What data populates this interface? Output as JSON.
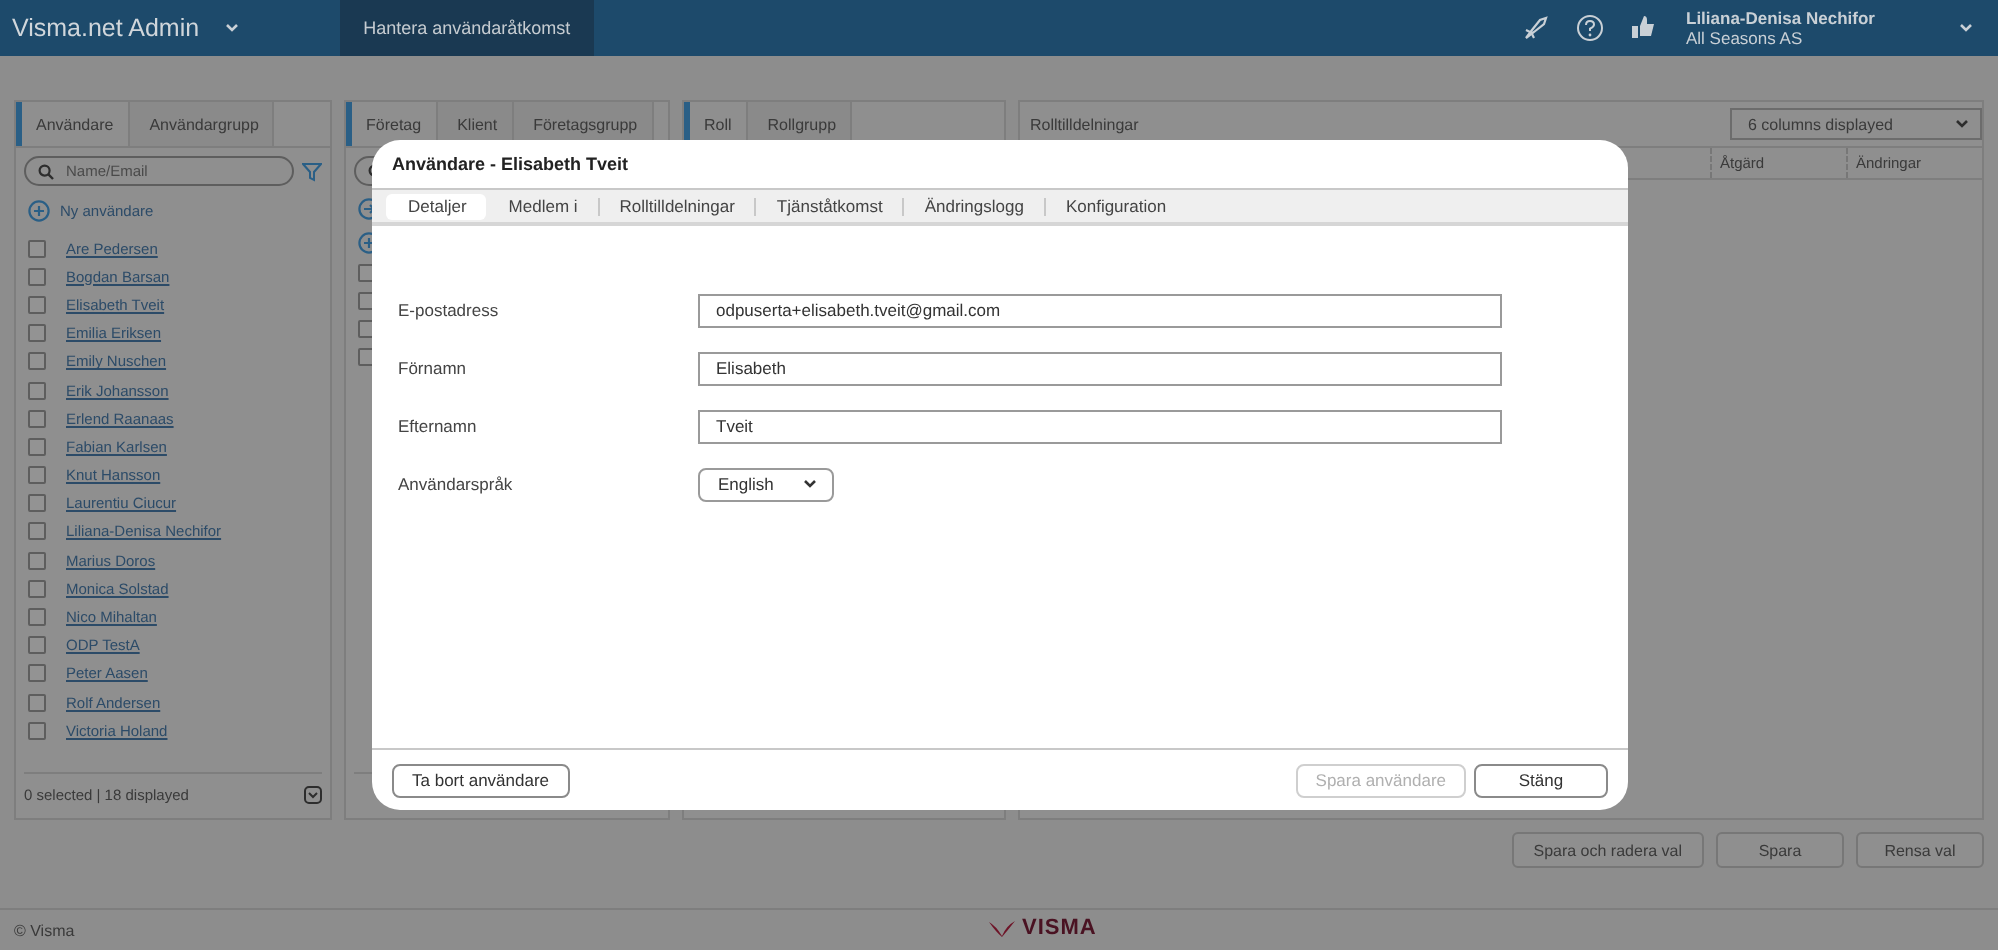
{
  "header": {
    "app_title": "Visma.net Admin",
    "nav_tab": "Hantera användaråtkomst",
    "user_name": "Liliana-Denisa Nechifor",
    "company": "All Seasons AS"
  },
  "users_panel": {
    "tabs": [
      {
        "label": "Användare",
        "selected": true
      },
      {
        "label": "Användargrupp",
        "selected": false
      }
    ],
    "search": {
      "placeholder": "Name/Email"
    },
    "new_link": "Ny användare",
    "users": [
      {
        "name": "Are Pedersen",
        "checked": false
      },
      {
        "name": "Bogdan Barsan",
        "checked": false
      },
      {
        "name": "Elisabeth Tveit",
        "checked": false
      },
      {
        "name": "Emilia Eriksen",
        "checked": false
      },
      {
        "name": "Emily Nuschen",
        "checked": false
      },
      {
        "name": "Erik Johansson",
        "checked": false
      },
      {
        "name": "Erlend Raanaas",
        "checked": false
      },
      {
        "name": "Fabian Karlsen",
        "checked": false
      },
      {
        "name": "Knut Hansson",
        "checked": false
      },
      {
        "name": "Laurentiu Ciucur",
        "checked": false
      },
      {
        "name": "Liliana-Denisa Nechifor",
        "checked": false
      },
      {
        "name": "Marius Doros",
        "checked": false
      },
      {
        "name": "Monica Solstad",
        "checked": false
      },
      {
        "name": "Nico Mihaltan",
        "checked": false
      },
      {
        "name": "ODP TestA",
        "checked": false
      },
      {
        "name": "Peter Aasen",
        "checked": false
      },
      {
        "name": "Rolf Andersen",
        "checked": false
      },
      {
        "name": "Victoria Holand",
        "checked": false
      }
    ],
    "status": "0 selected | 18 displayed"
  },
  "companies_panel": {
    "tabs": [
      {
        "label": "Företag",
        "selected": true
      },
      {
        "label": "Klient",
        "selected": false
      },
      {
        "label": "Företagsgrupp",
        "selected": false
      }
    ],
    "rows": [
      {
        "checked": false
      },
      {
        "checked": false
      },
      {
        "checked": false
      },
      {
        "checked": false
      }
    ]
  },
  "roles_panel": {
    "tabs": [
      {
        "label": "Roll",
        "selected": true
      },
      {
        "label": "Rollgrupp",
        "selected": false
      }
    ]
  },
  "assignments_panel": {
    "title": "Rolltilldelningar",
    "columns_select": "6 columns displayed",
    "columns": [
      "Åtgärd",
      "Ändringar"
    ]
  },
  "actions": [
    "Spara och radera val",
    "Spara",
    "Rensa val"
  ],
  "footer": {
    "copyright": "© Visma",
    "logo": "VISMA"
  },
  "dialog": {
    "title": "Användare - Elisabeth Tveit",
    "tabs": [
      {
        "label": "Detaljer",
        "selected": true
      },
      {
        "label": "Medlem i",
        "selected": false
      },
      {
        "label": "Rolltilldelningar",
        "selected": false
      },
      {
        "label": "Tjänståtkomst",
        "selected": false
      },
      {
        "label": "Ändringslogg",
        "selected": false
      },
      {
        "label": "Konfiguration",
        "selected": false
      }
    ],
    "fields": [
      {
        "label": "E-postadress",
        "kind": "text",
        "value": "odpuserta+elisabeth.tveit@gmail.com"
      },
      {
        "label": "Förnamn",
        "kind": "text",
        "value": "Elisabeth"
      },
      {
        "label": "Efternamn",
        "kind": "text",
        "value": "Tveit"
      },
      {
        "label": "Användarspråk",
        "kind": "select",
        "value": "English"
      }
    ],
    "buttons": [
      {
        "label": "Ta bort användare",
        "kind": "left",
        "disabled": false
      },
      {
        "label": "Spara användare",
        "kind": "right",
        "disabled": true
      },
      {
        "label": "Stäng",
        "kind": "right",
        "disabled": false
      }
    ]
  }
}
